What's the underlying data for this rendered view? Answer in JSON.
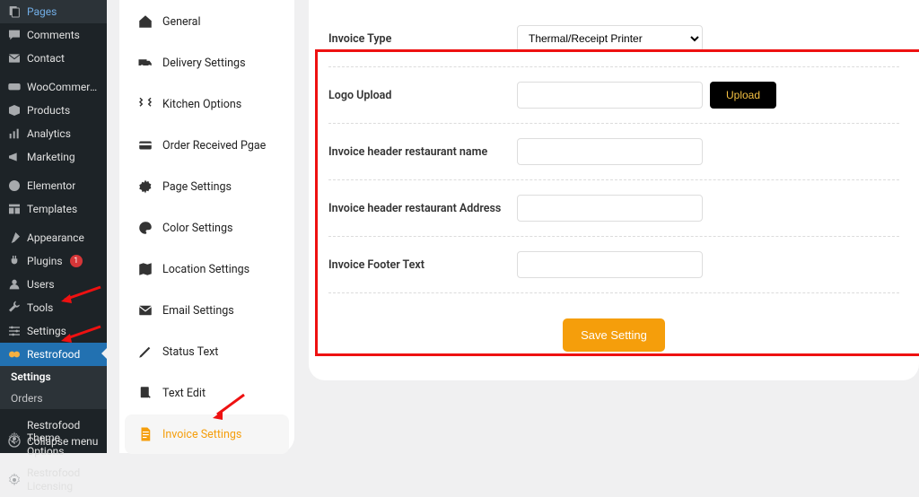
{
  "wp_sidebar": {
    "items": [
      {
        "label": "Pages",
        "icon": "pages"
      },
      {
        "label": "Comments",
        "icon": "comment"
      },
      {
        "label": "Contact",
        "icon": "mail"
      },
      {
        "label": "WooCommerce",
        "icon": "woo"
      },
      {
        "label": "Products",
        "icon": "box"
      },
      {
        "label": "Analytics",
        "icon": "chart"
      },
      {
        "label": "Marketing",
        "icon": "megaphone"
      },
      {
        "label": "Elementor",
        "icon": "elementor"
      },
      {
        "label": "Templates",
        "icon": "templates"
      },
      {
        "label": "Appearance",
        "icon": "brush"
      },
      {
        "label": "Plugins",
        "icon": "plug",
        "badge": "1"
      },
      {
        "label": "Users",
        "icon": "user"
      },
      {
        "label": "Tools",
        "icon": "wrench"
      },
      {
        "label": "Settings",
        "icon": "sliders"
      },
      {
        "label": "Restrofood",
        "icon": "restrofood",
        "active": true
      }
    ],
    "sub": [
      {
        "label": "Settings",
        "selected": true
      },
      {
        "label": "Orders"
      }
    ],
    "extra": [
      {
        "label": "Restrofood Theme Options",
        "icon": "gear"
      },
      {
        "label": "Restrofood Licensing",
        "icon": "gear"
      }
    ],
    "collapse": "Collapse menu"
  },
  "tabs": {
    "items": [
      {
        "label": "General",
        "icon": "home"
      },
      {
        "label": "Delivery Settings",
        "icon": "truck"
      },
      {
        "label": "Kitchen Options",
        "icon": "utensils"
      },
      {
        "label": "Order Received Pgae",
        "icon": "card"
      },
      {
        "label": "Page Settings",
        "icon": "gear"
      },
      {
        "label": "Color Settings",
        "icon": "palette"
      },
      {
        "label": "Location Settings",
        "icon": "map"
      },
      {
        "label": "Email Settings",
        "icon": "mail"
      },
      {
        "label": "Status Text",
        "icon": "pen"
      },
      {
        "label": "Text Edit",
        "icon": "file-pen"
      },
      {
        "label": "Invoice Settings",
        "icon": "file-lines",
        "active": true
      }
    ]
  },
  "form": {
    "invoice_type_label": "Invoice Type",
    "invoice_type_value": "Thermal/Receipt Printer",
    "logo_upload_label": "Logo Upload",
    "upload_btn": "Upload",
    "header_name_label": "Invoice header restaurant name",
    "header_addr_label": "Invoice header restaurant Address",
    "footer_label": "Invoice Footer Text",
    "save_btn": "Save Setting"
  }
}
